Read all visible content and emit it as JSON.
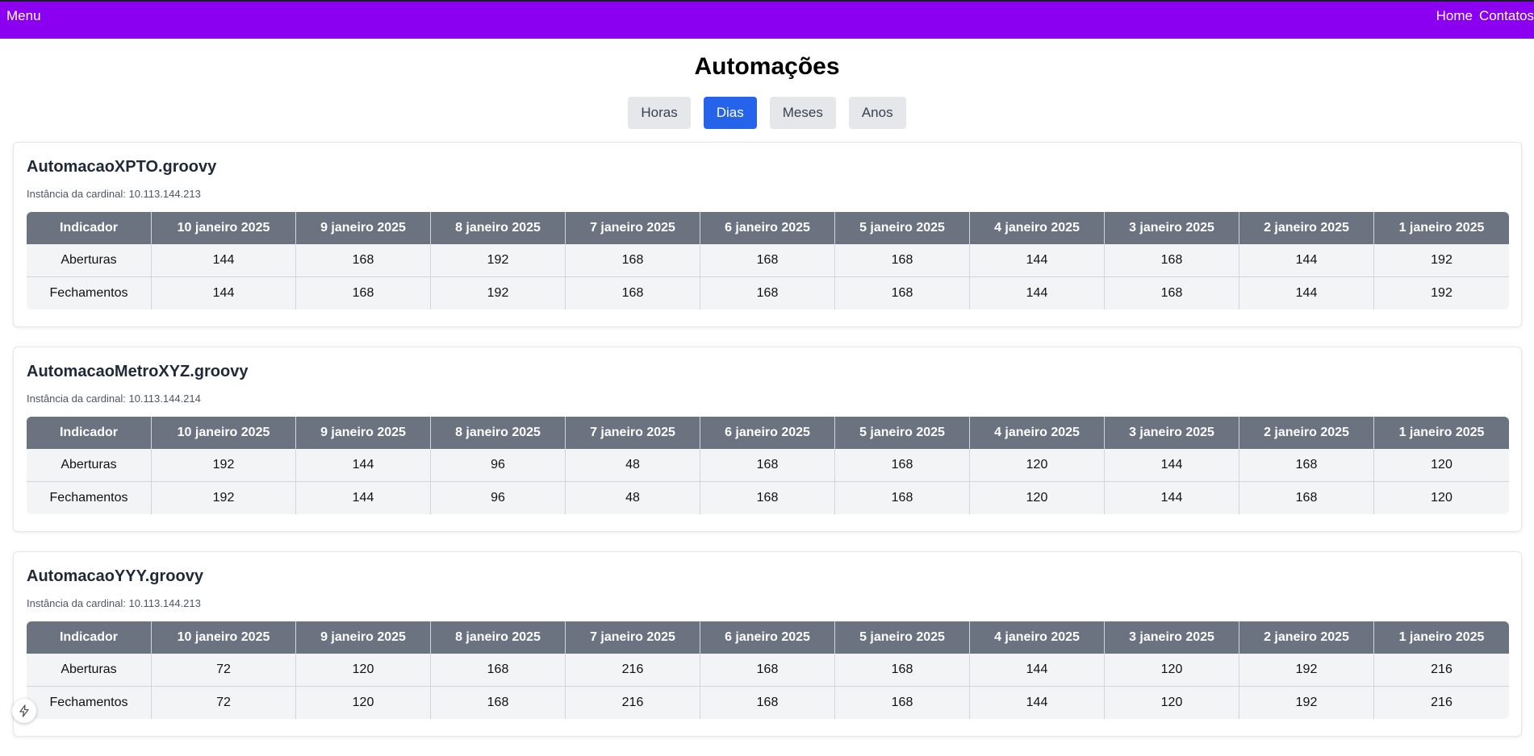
{
  "topbar": {
    "menu_label": "Menu",
    "links": [
      "Home",
      "Contatos"
    ],
    "color": "#8b00f0"
  },
  "page": {
    "title": "Automações"
  },
  "tabs": [
    {
      "label": "Horas",
      "active": false
    },
    {
      "label": "Dias",
      "active": true
    },
    {
      "label": "Meses",
      "active": false
    },
    {
      "label": "Anos",
      "active": false
    }
  ],
  "table_headers": [
    "Indicador",
    "10 janeiro 2025",
    "9 janeiro 2025",
    "8 janeiro 2025",
    "7 janeiro 2025",
    "6 janeiro 2025",
    "5 janeiro 2025",
    "4 janeiro 2025",
    "3 janeiro 2025",
    "2 janeiro 2025",
    "1 janeiro 2025"
  ],
  "cards": [
    {
      "title": "AutomacaoXPTO.groovy",
      "instance": "Instância da cardinal: 10.113.144.213",
      "rows": [
        {
          "label": "Aberturas",
          "values": [
            "144",
            "168",
            "192",
            "168",
            "168",
            "168",
            "144",
            "168",
            "144",
            "192"
          ]
        },
        {
          "label": "Fechamentos",
          "values": [
            "144",
            "168",
            "192",
            "168",
            "168",
            "168",
            "144",
            "168",
            "144",
            "192"
          ]
        }
      ]
    },
    {
      "title": "AutomacaoMetroXYZ.groovy",
      "instance": "Instância da cardinal: 10.113.144.214",
      "rows": [
        {
          "label": "Aberturas",
          "values": [
            "192",
            "144",
            "96",
            "48",
            "168",
            "168",
            "120",
            "144",
            "168",
            "120"
          ]
        },
        {
          "label": "Fechamentos",
          "values": [
            "192",
            "144",
            "96",
            "48",
            "168",
            "168",
            "120",
            "144",
            "168",
            "120"
          ]
        }
      ]
    },
    {
      "title": "AutomacaoYYY.groovy",
      "instance": "Instância da cardinal: 10.113.144.213",
      "rows": [
        {
          "label": "Aberturas",
          "values": [
            "72",
            "120",
            "168",
            "216",
            "168",
            "168",
            "144",
            "120",
            "192",
            "216"
          ]
        },
        {
          "label": "Fechamentos",
          "values": [
            "72",
            "120",
            "168",
            "216",
            "168",
            "168",
            "144",
            "120",
            "192",
            "216"
          ]
        }
      ]
    }
  ],
  "floating_button": {
    "icon": "lightning-icon"
  }
}
